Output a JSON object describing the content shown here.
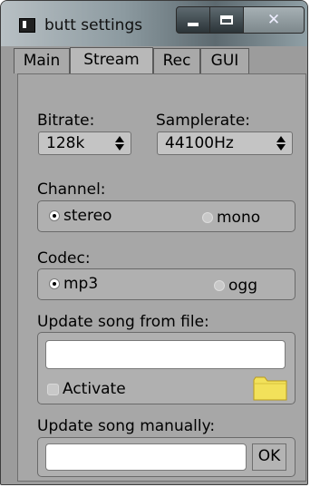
{
  "window": {
    "title": "butt settings",
    "icon": "butt-app-icon",
    "controls": {
      "minimize": "minimize-icon",
      "maximize": "maximize-icon",
      "close": "close-icon"
    }
  },
  "tabs": [
    {
      "label": "Main",
      "active": false
    },
    {
      "label": "Stream",
      "active": true
    },
    {
      "label": "Rec",
      "active": false
    },
    {
      "label": "GUI",
      "active": false
    }
  ],
  "stream": {
    "bitrate": {
      "label": "Bitrate:",
      "value": "128k"
    },
    "samplerate": {
      "label": "Samplerate:",
      "value": "44100Hz"
    },
    "channel": {
      "label": "Channel:",
      "options": [
        {
          "label": "stereo",
          "selected": true
        },
        {
          "label": "mono",
          "selected": false
        }
      ]
    },
    "codec": {
      "label": "Codec:",
      "options": [
        {
          "label": "mp3",
          "selected": true
        },
        {
          "label": "ogg",
          "selected": false
        }
      ]
    },
    "song_file": {
      "label": "Update song from file:",
      "value": "",
      "placeholder": "",
      "activate_label": "Activate",
      "activate_checked": false
    },
    "song_manual": {
      "label": "Update song manually:",
      "value": "",
      "placeholder": "",
      "ok_label": "OK"
    }
  },
  "colors": {
    "window_bg": "#9c9c9c",
    "panel_bg": "#a7a7a7",
    "folder": "#f2e15a"
  }
}
